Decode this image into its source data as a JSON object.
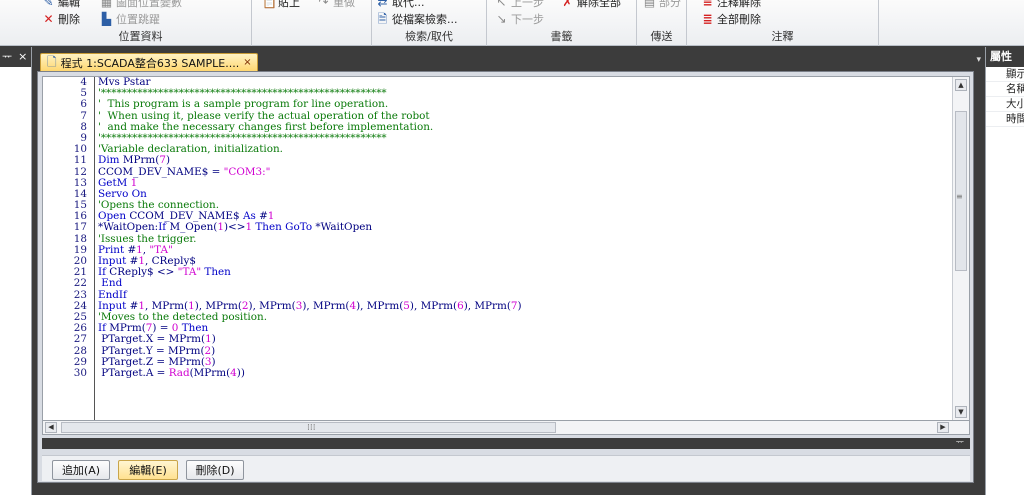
{
  "ribbon": {
    "groups": [
      {
        "label": "位置資料",
        "items": [
          {
            "label": "編輯",
            "icon": "edit-icon",
            "dim": false
          },
          {
            "label": "圖面位置變數",
            "icon": "position-variable-icon",
            "dim": true
          },
          {
            "label": "刪除",
            "icon": "delete-icon",
            "dim": false
          },
          {
            "label": "位置跳躍",
            "icon": "position-jump-icon",
            "dim": true
          }
        ]
      },
      {
        "label": "",
        "items": [
          {
            "label": "貼上",
            "icon": "paste-icon",
            "dim": false
          },
          {
            "label": "重做",
            "icon": "redo-icon",
            "dim": true
          }
        ]
      },
      {
        "label": "檢索/取代",
        "items": [
          {
            "label": "取代...",
            "icon": "replace-icon",
            "dim": false
          },
          {
            "label": "從檔案檢索...",
            "icon": "file-search-icon",
            "dim": false
          }
        ]
      },
      {
        "label": "書籤",
        "items": [
          {
            "label": "上一步",
            "icon": "prev-bookmark-icon",
            "dim": true
          },
          {
            "label": "解除全部",
            "icon": "clear-bookmarks-icon",
            "dim": false
          },
          {
            "label": "下一步",
            "icon": "next-bookmark-icon",
            "dim": true
          }
        ]
      },
      {
        "label": "傳送",
        "items": [
          {
            "label": "部分",
            "icon": "partial-transfer-icon",
            "dim": true
          }
        ]
      },
      {
        "label": "注釋",
        "items": [
          {
            "label": "注釋解除",
            "icon": "uncomment-icon",
            "dim": false
          },
          {
            "label": "全部刪除",
            "icon": "delete-all-comments-icon",
            "dim": false
          }
        ]
      }
    ]
  },
  "left_pane": {
    "header_glyph": "ᅲ",
    "close": "×"
  },
  "document": {
    "tab_title": "程式 1:SCADA整合633 SAMPLE....",
    "tab_close": "×",
    "tab_dropdown": "▾",
    "code_lines": [
      {
        "n": "4",
        "parts": [
          [
            "id",
            "Mvs Pstar"
          ]
        ]
      },
      {
        "n": "5",
        "parts": [
          [
            "comment",
            "'*******************************************************"
          ]
        ]
      },
      {
        "n": "6",
        "parts": [
          [
            "comment",
            "'  This program is a sample program for line operation."
          ]
        ]
      },
      {
        "n": "7",
        "parts": [
          [
            "comment",
            "'  When using it, please verify the actual operation of the robot"
          ]
        ]
      },
      {
        "n": "8",
        "parts": [
          [
            "comment",
            "'  and make the necessary changes first before implementation."
          ]
        ]
      },
      {
        "n": "9",
        "parts": [
          [
            "comment",
            "'*******************************************************"
          ]
        ]
      },
      {
        "n": "10",
        "parts": [
          [
            "comment",
            "'Variable declaration, initialization."
          ]
        ]
      },
      {
        "n": "11",
        "parts": [
          [
            "kw",
            "Dim "
          ],
          [
            "id",
            "MPrm("
          ],
          [
            "num",
            "7"
          ],
          [
            "id",
            ")"
          ]
        ]
      },
      {
        "n": "12",
        "parts": [
          [
            "id",
            "CCOM_DEV_NAME$ = "
          ],
          [
            "str",
            "\"COM3:\""
          ]
        ]
      },
      {
        "n": "13",
        "parts": [
          [
            "kw",
            "GetM "
          ],
          [
            "num",
            "1"
          ]
        ]
      },
      {
        "n": "14",
        "parts": [
          [
            "kw",
            "Servo On"
          ]
        ]
      },
      {
        "n": "15",
        "parts": [
          [
            "comment",
            "'Opens the connection."
          ]
        ]
      },
      {
        "n": "16",
        "parts": [
          [
            "kw",
            "Open "
          ],
          [
            "id",
            "CCOM_DEV_NAME$ "
          ],
          [
            "kw",
            "As "
          ],
          [
            "id",
            "#"
          ],
          [
            "num",
            "1"
          ]
        ]
      },
      {
        "n": "17",
        "parts": [
          [
            "id",
            "*WaitOpen:"
          ],
          [
            "kw",
            "If "
          ],
          [
            "id",
            "M_Open("
          ],
          [
            "num",
            "1"
          ],
          [
            "id",
            ")<>"
          ],
          [
            "num",
            "1"
          ],
          [
            "kw",
            " Then GoTo "
          ],
          [
            "id",
            "*WaitOpen"
          ]
        ]
      },
      {
        "n": "18",
        "parts": [
          [
            "comment",
            "'Issues the trigger."
          ]
        ]
      },
      {
        "n": "19",
        "parts": [
          [
            "kw",
            "Print "
          ],
          [
            "id",
            "#"
          ],
          [
            "num",
            "1"
          ],
          [
            "id",
            ", "
          ],
          [
            "str",
            "\"TA\""
          ]
        ]
      },
      {
        "n": "20",
        "parts": [
          [
            "kw",
            "Input "
          ],
          [
            "id",
            "#"
          ],
          [
            "num",
            "1"
          ],
          [
            "id",
            ", CReply$"
          ]
        ]
      },
      {
        "n": "21",
        "parts": [
          [
            "kw",
            "If "
          ],
          [
            "id",
            "CReply$ <> "
          ],
          [
            "str",
            "\"TA\""
          ],
          [
            "kw",
            " Then"
          ]
        ]
      },
      {
        "n": "22",
        "parts": [
          [
            "kw",
            " End"
          ]
        ]
      },
      {
        "n": "23",
        "parts": [
          [
            "kw",
            "EndIf"
          ]
        ]
      },
      {
        "n": "24",
        "parts": [
          [
            "kw",
            "Input "
          ],
          [
            "id",
            "#"
          ],
          [
            "num",
            "1"
          ],
          [
            "id",
            ", MPrm("
          ],
          [
            "num",
            "1"
          ],
          [
            "id",
            "), MPrm("
          ],
          [
            "num",
            "2"
          ],
          [
            "id",
            "), MPrm("
          ],
          [
            "num",
            "3"
          ],
          [
            "id",
            "), MPrm("
          ],
          [
            "num",
            "4"
          ],
          [
            "id",
            "), MPrm("
          ],
          [
            "num",
            "5"
          ],
          [
            "id",
            "), MPrm("
          ],
          [
            "num",
            "6"
          ],
          [
            "id",
            "), MPrm("
          ],
          [
            "num",
            "7"
          ],
          [
            "id",
            ")"
          ]
        ]
      },
      {
        "n": "25",
        "parts": [
          [
            "comment",
            "'Moves to the detected position."
          ]
        ]
      },
      {
        "n": "26",
        "parts": [
          [
            "kw",
            "If "
          ],
          [
            "id",
            "MPrm("
          ],
          [
            "num",
            "7"
          ],
          [
            "id",
            ") = "
          ],
          [
            "num",
            "0"
          ],
          [
            "kw",
            " Then"
          ]
        ]
      },
      {
        "n": "27",
        "parts": [
          [
            "id",
            " PTarget.X = MPrm("
          ],
          [
            "num",
            "1"
          ],
          [
            "id",
            ")"
          ]
        ]
      },
      {
        "n": "28",
        "parts": [
          [
            "id",
            " PTarget.Y = MPrm("
          ],
          [
            "num",
            "2"
          ],
          [
            "id",
            ")"
          ]
        ]
      },
      {
        "n": "29",
        "parts": [
          [
            "id",
            " PTarget.Z = MPrm("
          ],
          [
            "num",
            "3"
          ],
          [
            "id",
            ")"
          ]
        ]
      },
      {
        "n": "30",
        "parts": [
          [
            "id",
            " PTarget.A = "
          ],
          [
            "str",
            "Rad"
          ],
          [
            "id",
            "(MPrm("
          ],
          [
            "num",
            "4"
          ],
          [
            "id",
            "))"
          ]
        ]
      }
    ],
    "buttons": [
      {
        "name": "add-button",
        "label": "追加(A)",
        "active": false
      },
      {
        "name": "edit-button",
        "label": "編輯(E)",
        "active": true
      },
      {
        "name": "delete-button",
        "label": "刪除(D)",
        "active": false
      }
    ],
    "pin_glyph": "ᅲ"
  },
  "right_pane": {
    "header": "屬性",
    "props": [
      "顯示",
      "名稱",
      "大小",
      "時間"
    ]
  }
}
